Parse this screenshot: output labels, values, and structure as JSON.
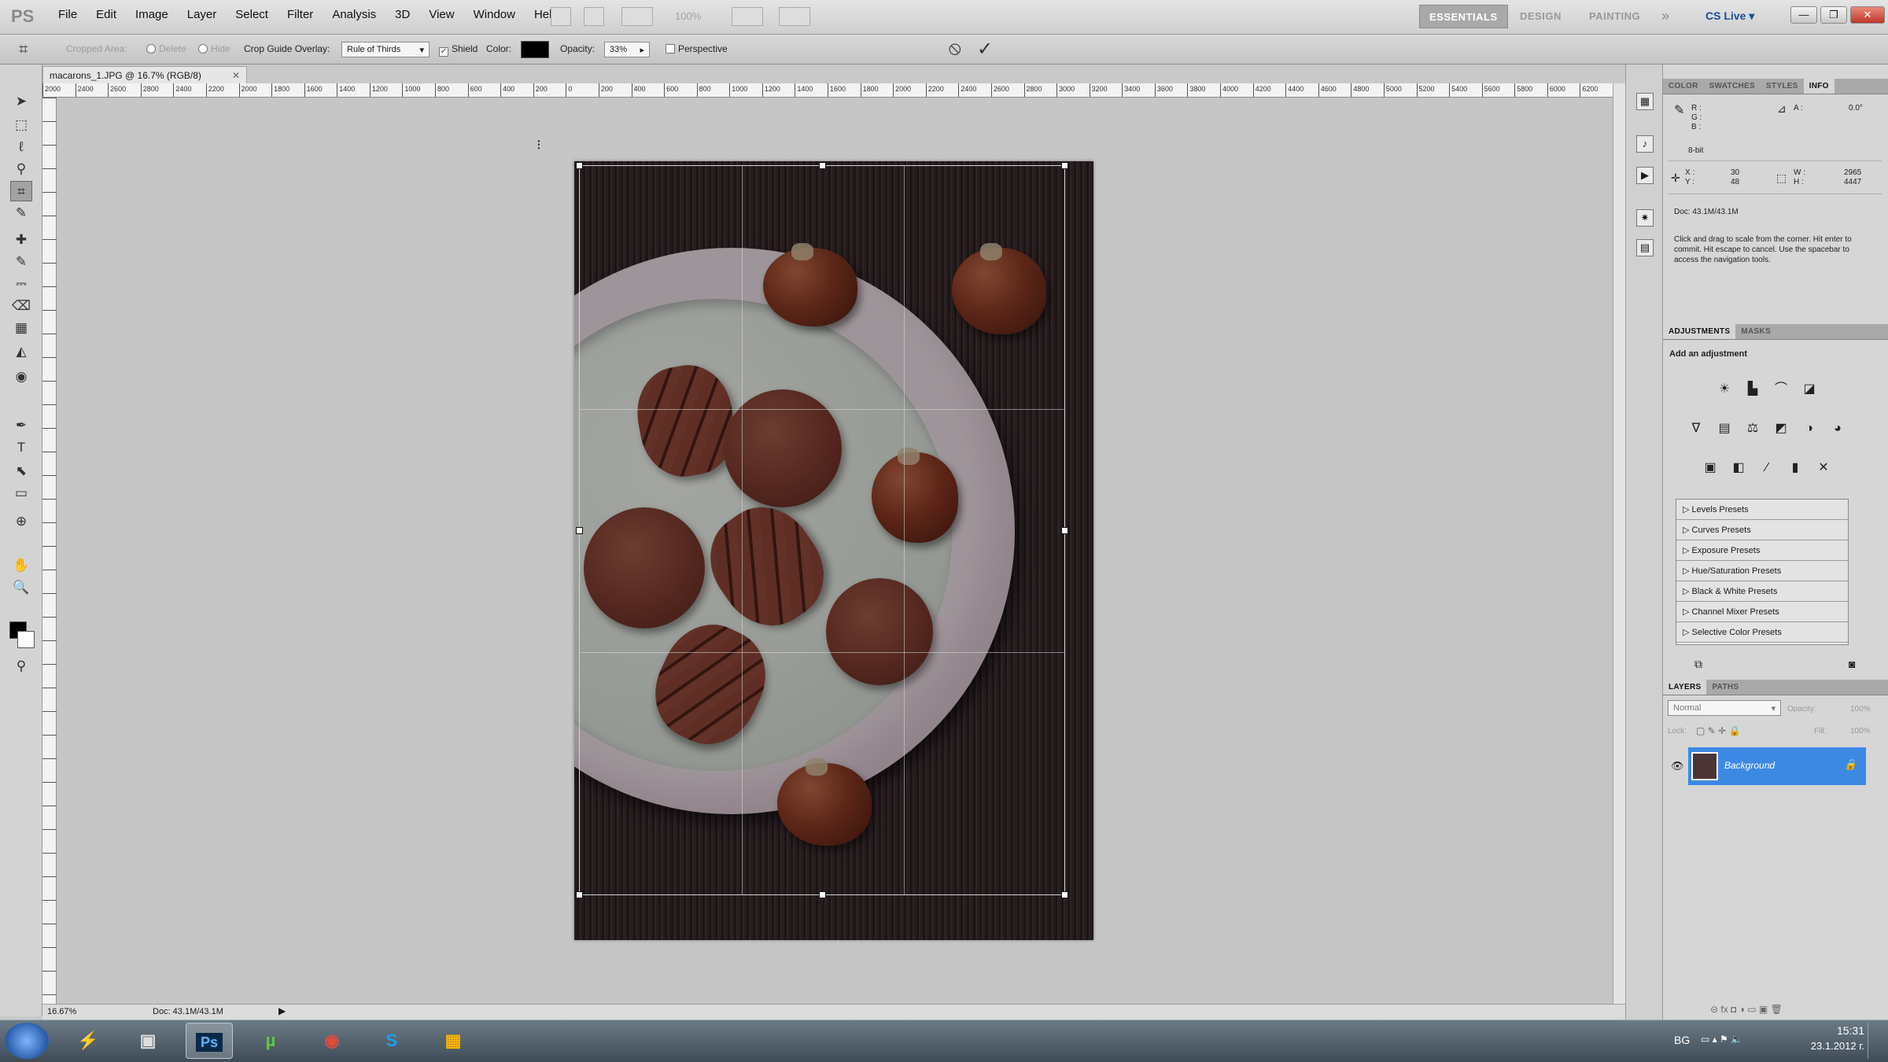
{
  "app": {
    "logo": "PS"
  },
  "menubar": {
    "items": [
      "File",
      "Edit",
      "Image",
      "Layer",
      "Select",
      "Filter",
      "Analysis",
      "3D",
      "View",
      "Window",
      "Help"
    ],
    "zoom": "100%",
    "workspaces": [
      "ESSENTIALS",
      "DESIGN",
      "PAINTING"
    ],
    "more": "»",
    "cslive": "CS Live ▾",
    "window_buttons": [
      "—",
      "❐",
      "✕"
    ]
  },
  "options": {
    "cropped_area_label": "Cropped Area:",
    "delete_label": "Delete",
    "hide_label": "Hide",
    "crop_guide_label": "Crop Guide Overlay:",
    "crop_guide_value": "Rule of Thirds",
    "shield_label": "Shield",
    "color_label": "Color:",
    "opacity_label": "Opacity:",
    "opacity_value": "33%",
    "perspective_label": "Perspective",
    "cancel_glyph": "⦸",
    "commit_glyph": "✓"
  },
  "document": {
    "tab_title": "macarons_1.JPG @ 16.7% (RGB/8)",
    "ruler_labels": [
      "2000",
      "2400",
      "2600",
      "2800",
      "2400",
      "2200",
      "2000",
      "1800",
      "1600",
      "1400",
      "1200",
      "1000",
      "800",
      "600",
      "400",
      "200",
      "0",
      "200",
      "400",
      "600",
      "800",
      "1000",
      "1200",
      "1400",
      "1600",
      "1800",
      "2000",
      "2200",
      "2400",
      "2600",
      "2800",
      "3000",
      "3200",
      "3400",
      "3600",
      "3800",
      "4000",
      "4200",
      "4400",
      "4600",
      "4800",
      "5000",
      "5200",
      "5400",
      "5600",
      "5800",
      "6000",
      "6200"
    ],
    "zoom_status": "16.67%",
    "doc_status": "Doc: 43.1M/43.1M"
  },
  "tools": [
    "➤",
    "⬚",
    "ℓ",
    "⚲",
    "⌗",
    "✎",
    "✚",
    "✎",
    "⎓",
    "⌫",
    "▦",
    "◭",
    "◉",
    "✒",
    "T",
    "⬉",
    "▭",
    "⊕",
    "✋",
    "🔍",
    "⚲"
  ],
  "panels": {
    "top_tabs": [
      "COLOR",
      "SWATCHES",
      "STYLES",
      "INFO"
    ],
    "info": {
      "r": "R :",
      "g": "G :",
      "b": "B :",
      "a_label": "A :",
      "a_value": "0.0°",
      "bit": "8-bit",
      "x": "X :",
      "y": "Y :",
      "x_value": "30",
      "y_value": "48",
      "w": "W :",
      "h": "H :",
      "w_value": "2965",
      "h_value": "4447",
      "doc": "Doc: 43.1M/43.1M",
      "hint": "Click and drag to scale from the corner. Hit enter to commit. Hit escape to cancel. Use the spacebar to access the navigation tools."
    },
    "adjust_tabs": [
      "ADJUSTMENTS",
      "MASKS"
    ],
    "add_adjustment": "Add an adjustment",
    "adjust_icons": [
      "☀",
      "▙",
      "⌒",
      "◪",
      "∇",
      "▤",
      "⚖",
      "◩",
      "◑",
      "◕",
      "▣",
      "◧",
      "⁄",
      "▮",
      "✕"
    ],
    "presets": [
      "Levels Presets",
      "Curves Presets",
      "Exposure Presets",
      "Hue/Saturation Presets",
      "Black & White Presets",
      "Channel Mixer Presets",
      "Selective Color Presets"
    ],
    "layers_tabs": [
      "LAYERS",
      "PATHS"
    ],
    "blend_mode": "Normal",
    "opacity_label": "Opacity:",
    "opacity_value": "100%",
    "lock_label": "Lock:",
    "fill_label": "Fill:",
    "fill_value": "100%",
    "layer_name": "Background"
  },
  "taskbar": {
    "lang": "BG",
    "time": "15:31",
    "date": "23.1.2012 г."
  }
}
